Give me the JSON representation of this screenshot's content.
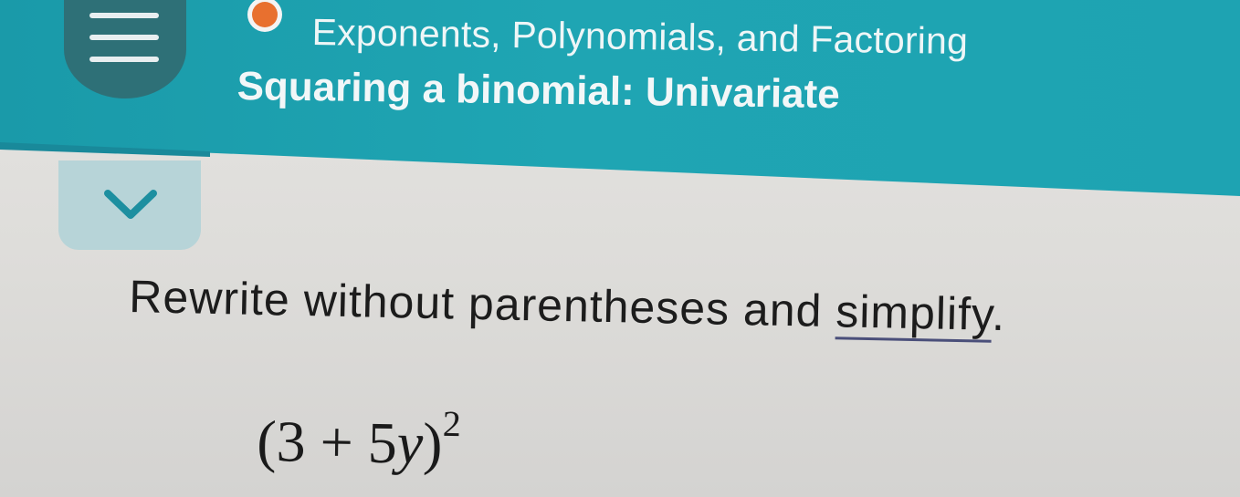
{
  "header": {
    "topic": "Exponents, Polynomials, and Factoring",
    "lesson": "Squaring a binomial: Univariate",
    "topic_dot_color": "#e8702f",
    "accent_color": "#1fa5b3"
  },
  "icons": {
    "menu": "hamburger-menu-icon",
    "collapse": "chevron-down-icon"
  },
  "problem": {
    "instruction_prefix": "Rewrite without parentheses and ",
    "instruction_link": "simplify",
    "instruction_suffix": ".",
    "expression": {
      "open": "(3 + 5",
      "variable": "y",
      "close": ")",
      "exponent": "2"
    }
  }
}
